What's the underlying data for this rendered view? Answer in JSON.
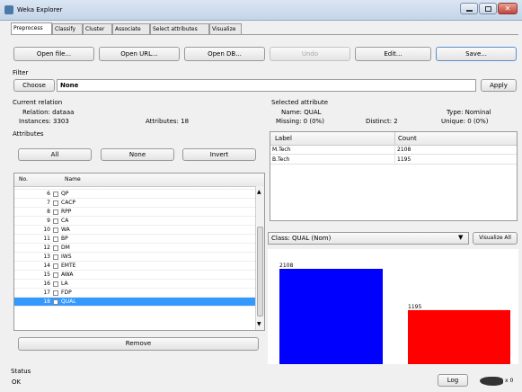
{
  "window": {
    "title": "Weka Explorer"
  },
  "tabs": [
    "Preprocess",
    "Classify",
    "Cluster",
    "Associate",
    "Select attributes",
    "Visualize"
  ],
  "toolbar": {
    "open_file": "Open file...",
    "open_url": "Open URL...",
    "open_db": "Open DB...",
    "undo": "Undo",
    "edit": "Edit...",
    "save": "Save..."
  },
  "filter": {
    "section": "Filter",
    "choose": "Choose",
    "value": "None",
    "apply": "Apply"
  },
  "relation": {
    "section": "Current relation",
    "relation_label": "Relation: dataaa",
    "instances_label": "Instances: 3303",
    "attributes_label": "Attributes: 18"
  },
  "attributes": {
    "section": "Attributes",
    "all": "All",
    "none": "None",
    "invert": "Invert",
    "col_no": "No.",
    "col_name": "Name",
    "rows": [
      {
        "no": "6",
        "name": "QP"
      },
      {
        "no": "7",
        "name": "CACP"
      },
      {
        "no": "8",
        "name": "RPP"
      },
      {
        "no": "9",
        "name": "CA"
      },
      {
        "no": "10",
        "name": "WA"
      },
      {
        "no": "11",
        "name": "BP"
      },
      {
        "no": "12",
        "name": "DM"
      },
      {
        "no": "13",
        "name": "IWS"
      },
      {
        "no": "14",
        "name": "EMTE"
      },
      {
        "no": "15",
        "name": "AWA"
      },
      {
        "no": "16",
        "name": "LA"
      },
      {
        "no": "17",
        "name": "FDP"
      },
      {
        "no": "18",
        "name": "QUAL"
      }
    ],
    "remove": "Remove"
  },
  "selected_attribute": {
    "section": "Selected attribute",
    "name": "Name: QUAL",
    "type": "Type: Nominal",
    "missing": "Missing: 0 (0%)",
    "distinct": "Distinct: 2",
    "unique": "Unique: 0 (0%)",
    "col_label": "Label",
    "col_count": "Count",
    "rows": [
      {
        "label": "M.Tech",
        "count": "2108"
      },
      {
        "label": "B.Tech",
        "count": "1195"
      }
    ]
  },
  "class_select": {
    "value": "Class: QUAL (Nom)",
    "visualize_all": "Visualize All"
  },
  "chart_data": {
    "type": "bar",
    "categories": [
      "M.Tech",
      "B.Tech"
    ],
    "values": [
      2108,
      1195
    ],
    "colors": [
      "#0000ff",
      "#ff0000"
    ],
    "data_labels": [
      "2108",
      "1195"
    ]
  },
  "status": {
    "section": "Status",
    "text": "OK",
    "log": "Log",
    "count": "x 0"
  }
}
